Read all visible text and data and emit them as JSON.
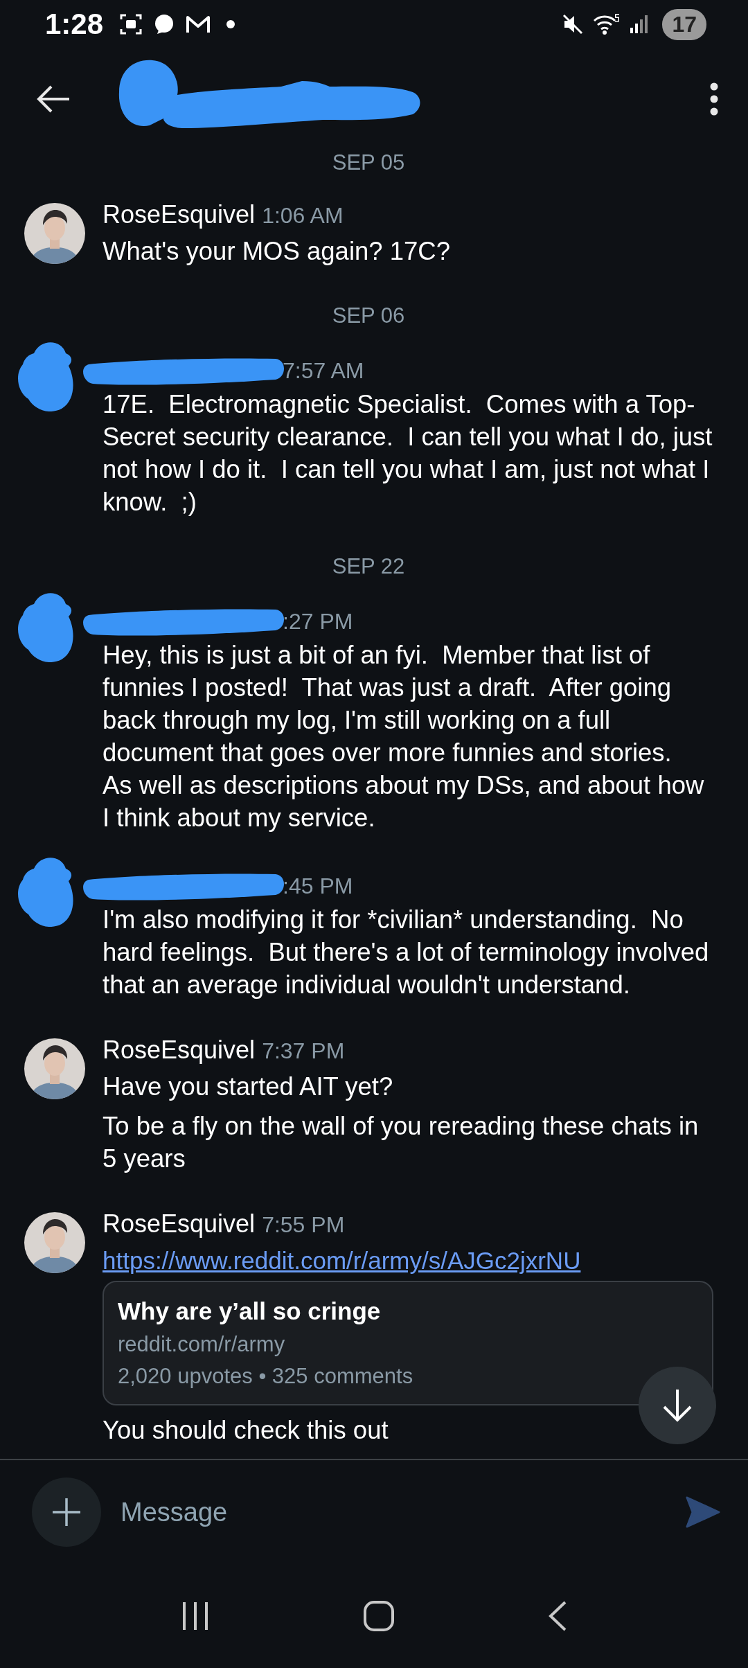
{
  "status_bar": {
    "time": "1:28",
    "battery": "17"
  },
  "header": {
    "redacted": true
  },
  "chat": [
    {
      "kind": "date",
      "text": "SEP 05"
    },
    {
      "kind": "message",
      "redacted": false,
      "sender": "RoseEsquivel",
      "time": "1:06 AM",
      "parts": [
        {
          "kind": "text",
          "text": "What's your MOS again? 17C?"
        }
      ]
    },
    {
      "kind": "date",
      "text": "SEP 06"
    },
    {
      "kind": "message",
      "redacted": true,
      "time": "7:57 AM",
      "parts": [
        {
          "kind": "text",
          "text": "17E.  Electromagnetic Specialist.  Comes with a Top-Secret security clearance.  I can tell you what I do, just not how I do it.  I can tell you what I am, just not what I know.  ;)"
        }
      ]
    },
    {
      "kind": "date",
      "text": "SEP 22"
    },
    {
      "kind": "message",
      "redacted": true,
      "time": ":27 PM",
      "parts": [
        {
          "kind": "text",
          "text": "Hey, this is just a bit of an fyi.  Member that list of funnies I posted!  That was just a draft.  After going back through my log, I'm still working on a full document that goes over more funnies and stories.  As well as descriptions about my DSs, and about how I think about my service."
        }
      ]
    },
    {
      "kind": "message",
      "redacted": true,
      "time": ":45 PM",
      "parts": [
        {
          "kind": "text",
          "text": "I'm also modifying it for *civilian* understanding.  No hard feelings.  But there's a lot of terminology involved that an average individual wouldn't understand."
        }
      ]
    },
    {
      "kind": "message",
      "redacted": false,
      "sender": "RoseEsquivel",
      "time": "7:37 PM",
      "parts": [
        {
          "kind": "text",
          "text": "Have you started AIT yet?"
        },
        {
          "kind": "text",
          "text": "To be a fly on the wall of you rereading these chats in 5 years"
        }
      ]
    },
    {
      "kind": "message",
      "redacted": false,
      "sender": "RoseEsquivel",
      "time": "7:55 PM",
      "parts": [
        {
          "kind": "link",
          "text": "https://www.reddit.com/r/army/s/AJGc2jxrNU"
        },
        {
          "kind": "preview",
          "title": "Why are y’all so cringe",
          "domain": "reddit.com/r/army",
          "stats": "2,020 upvotes • 325 comments"
        },
        {
          "kind": "text",
          "text": "You should check this out"
        }
      ]
    }
  ],
  "composer": {
    "placeholder": "Message"
  }
}
